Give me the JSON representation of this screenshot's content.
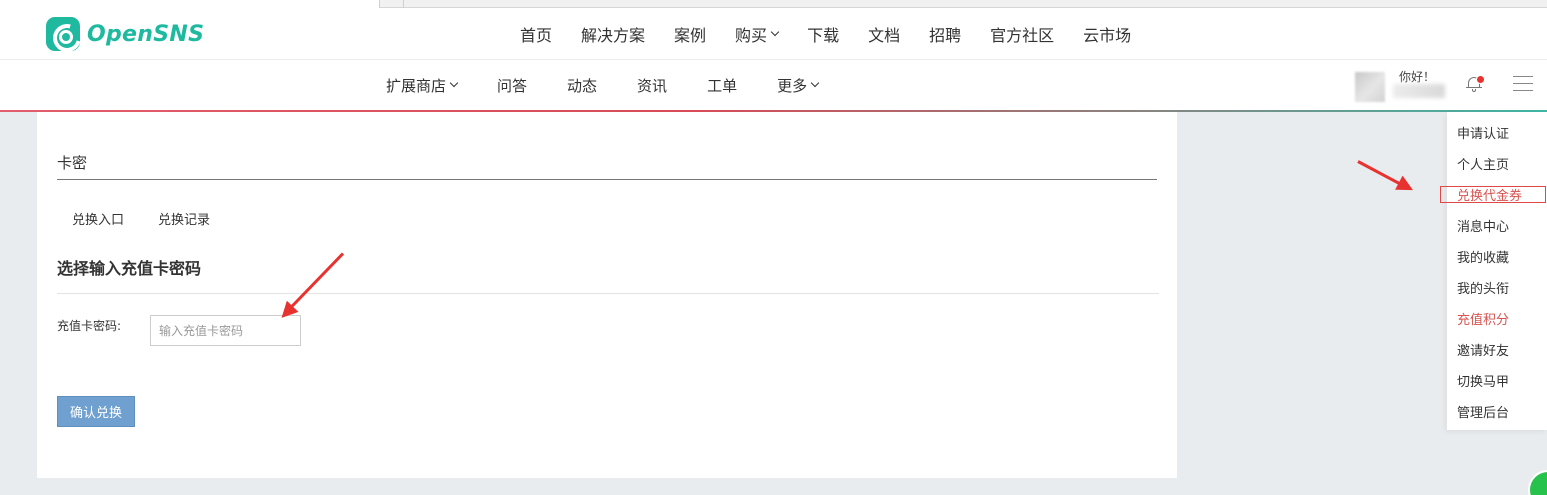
{
  "logo": {
    "text": "OpenSNS",
    "color": "#1fb9a0"
  },
  "main_nav": [
    {
      "label": "首页",
      "dropdown": false
    },
    {
      "label": "解决方案",
      "dropdown": false
    },
    {
      "label": "案例",
      "dropdown": false
    },
    {
      "label": "购买",
      "dropdown": true
    },
    {
      "label": "下载",
      "dropdown": false
    },
    {
      "label": "文档",
      "dropdown": false
    },
    {
      "label": "招聘",
      "dropdown": false
    },
    {
      "label": "官方社区",
      "dropdown": false
    },
    {
      "label": "云市场",
      "dropdown": false
    }
  ],
  "sub_nav": [
    {
      "label": "扩展商店",
      "dropdown": true
    },
    {
      "label": "问答",
      "dropdown": false
    },
    {
      "label": "动态",
      "dropdown": false
    },
    {
      "label": "资讯",
      "dropdown": false
    },
    {
      "label": "工单",
      "dropdown": false
    },
    {
      "label": "更多",
      "dropdown": true
    }
  ],
  "user": {
    "greeting": "你好！",
    "notification_dot_color": "#e8322f"
  },
  "card": {
    "title": "卡密",
    "tabs": [
      "兑换入口",
      "兑换记录"
    ],
    "section_title": "选择输入充值卡密码",
    "field_label": "充值卡密码:",
    "input_value": "",
    "input_placeholder": "输入充值卡密码",
    "submit_label": "确认兑换",
    "submit_color": "#6fa0cf"
  },
  "dropdown_menu": [
    {
      "label": "申请认证",
      "style": "normal"
    },
    {
      "label": "个人主页",
      "style": "normal"
    },
    {
      "label": "兑换代金券",
      "style": "red",
      "highlighted": true
    },
    {
      "label": "消息中心",
      "style": "normal"
    },
    {
      "label": "我的收藏",
      "style": "normal"
    },
    {
      "label": "我的头衔",
      "style": "normal"
    },
    {
      "label": "充值积分",
      "style": "red"
    },
    {
      "label": "邀请好友",
      "style": "normal"
    },
    {
      "label": "切换马甲",
      "style": "normal"
    },
    {
      "label": "管理后台",
      "style": "normal"
    }
  ],
  "annotation": {
    "arrow_color": "#e8322f",
    "box_color": "#e04848"
  }
}
